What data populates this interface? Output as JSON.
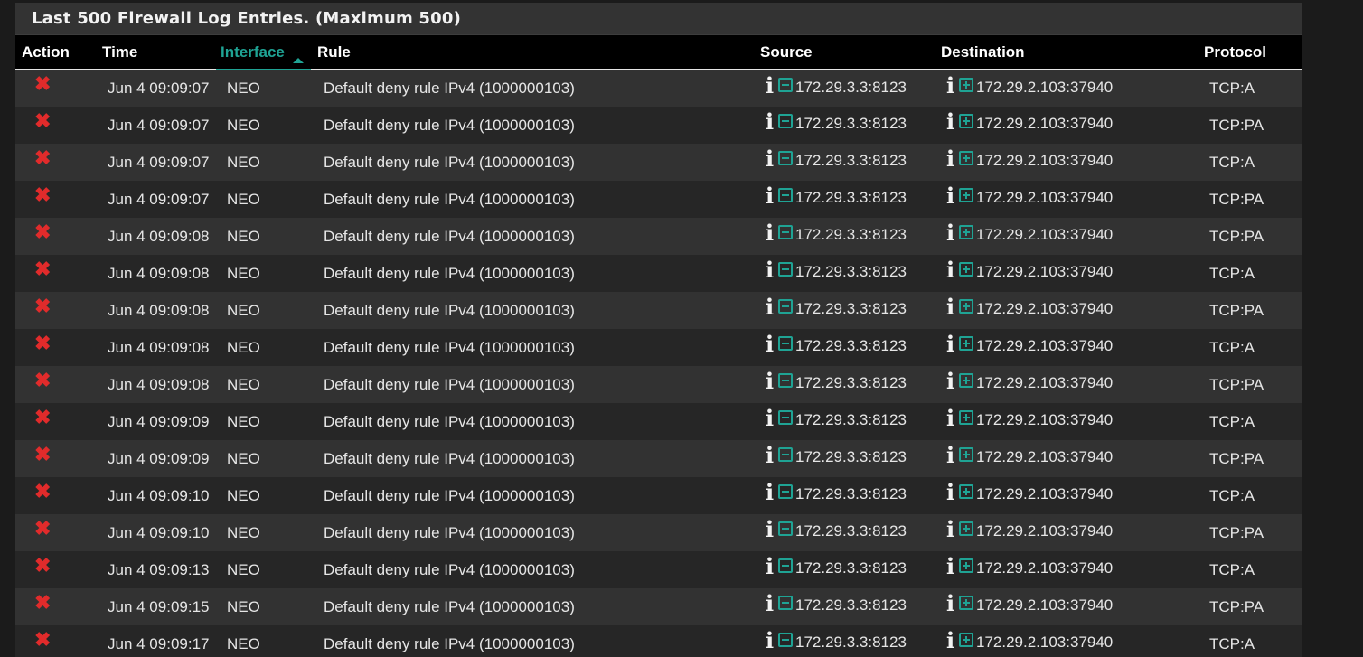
{
  "panel": {
    "title": "Last 500 Firewall Log Entries. (Maximum 500)"
  },
  "columns": {
    "action": "Action",
    "time": "Time",
    "interface": "Interface",
    "rule": "Rule",
    "source": "Source",
    "destination": "Destination",
    "protocol": "Protocol"
  },
  "sorted_column": "interface",
  "colors": {
    "accent": "#1fa394",
    "block": "#e12b2b"
  },
  "icons": {
    "action": "block-x-icon",
    "info": "info-icon",
    "source_rule": "minus-square-icon",
    "destination_rule": "plus-square-icon",
    "sort": "sort-asc-icon"
  },
  "rows": [
    {
      "time": "Jun 4 09:09:07",
      "interface": "NEO",
      "rule": "Default deny rule IPv4 (1000000103)",
      "source": "172.29.3.3:8123",
      "destination": "172.29.2.103:37940",
      "protocol": "TCP:A"
    },
    {
      "time": "Jun 4 09:09:07",
      "interface": "NEO",
      "rule": "Default deny rule IPv4 (1000000103)",
      "source": "172.29.3.3:8123",
      "destination": "172.29.2.103:37940",
      "protocol": "TCP:PA"
    },
    {
      "time": "Jun 4 09:09:07",
      "interface": "NEO",
      "rule": "Default deny rule IPv4 (1000000103)",
      "source": "172.29.3.3:8123",
      "destination": "172.29.2.103:37940",
      "protocol": "TCP:A"
    },
    {
      "time": "Jun 4 09:09:07",
      "interface": "NEO",
      "rule": "Default deny rule IPv4 (1000000103)",
      "source": "172.29.3.3:8123",
      "destination": "172.29.2.103:37940",
      "protocol": "TCP:PA"
    },
    {
      "time": "Jun 4 09:09:08",
      "interface": "NEO",
      "rule": "Default deny rule IPv4 (1000000103)",
      "source": "172.29.3.3:8123",
      "destination": "172.29.2.103:37940",
      "protocol": "TCP:PA"
    },
    {
      "time": "Jun 4 09:09:08",
      "interface": "NEO",
      "rule": "Default deny rule IPv4 (1000000103)",
      "source": "172.29.3.3:8123",
      "destination": "172.29.2.103:37940",
      "protocol": "TCP:A"
    },
    {
      "time": "Jun 4 09:09:08",
      "interface": "NEO",
      "rule": "Default deny rule IPv4 (1000000103)",
      "source": "172.29.3.3:8123",
      "destination": "172.29.2.103:37940",
      "protocol": "TCP:PA"
    },
    {
      "time": "Jun 4 09:09:08",
      "interface": "NEO",
      "rule": "Default deny rule IPv4 (1000000103)",
      "source": "172.29.3.3:8123",
      "destination": "172.29.2.103:37940",
      "protocol": "TCP:A"
    },
    {
      "time": "Jun 4 09:09:08",
      "interface": "NEO",
      "rule": "Default deny rule IPv4 (1000000103)",
      "source": "172.29.3.3:8123",
      "destination": "172.29.2.103:37940",
      "protocol": "TCP:PA"
    },
    {
      "time": "Jun 4 09:09:09",
      "interface": "NEO",
      "rule": "Default deny rule IPv4 (1000000103)",
      "source": "172.29.3.3:8123",
      "destination": "172.29.2.103:37940",
      "protocol": "TCP:A"
    },
    {
      "time": "Jun 4 09:09:09",
      "interface": "NEO",
      "rule": "Default deny rule IPv4 (1000000103)",
      "source": "172.29.3.3:8123",
      "destination": "172.29.2.103:37940",
      "protocol": "TCP:PA"
    },
    {
      "time": "Jun 4 09:09:10",
      "interface": "NEO",
      "rule": "Default deny rule IPv4 (1000000103)",
      "source": "172.29.3.3:8123",
      "destination": "172.29.2.103:37940",
      "protocol": "TCP:A"
    },
    {
      "time": "Jun 4 09:09:10",
      "interface": "NEO",
      "rule": "Default deny rule IPv4 (1000000103)",
      "source": "172.29.3.3:8123",
      "destination": "172.29.2.103:37940",
      "protocol": "TCP:PA"
    },
    {
      "time": "Jun 4 09:09:13",
      "interface": "NEO",
      "rule": "Default deny rule IPv4 (1000000103)",
      "source": "172.29.3.3:8123",
      "destination": "172.29.2.103:37940",
      "protocol": "TCP:A"
    },
    {
      "time": "Jun 4 09:09:15",
      "interface": "NEO",
      "rule": "Default deny rule IPv4 (1000000103)",
      "source": "172.29.3.3:8123",
      "destination": "172.29.2.103:37940",
      "protocol": "TCP:PA"
    },
    {
      "time": "Jun 4 09:09:17",
      "interface": "NEO",
      "rule": "Default deny rule IPv4 (1000000103)",
      "source": "172.29.3.3:8123",
      "destination": "172.29.2.103:37940",
      "protocol": "TCP:A"
    }
  ]
}
